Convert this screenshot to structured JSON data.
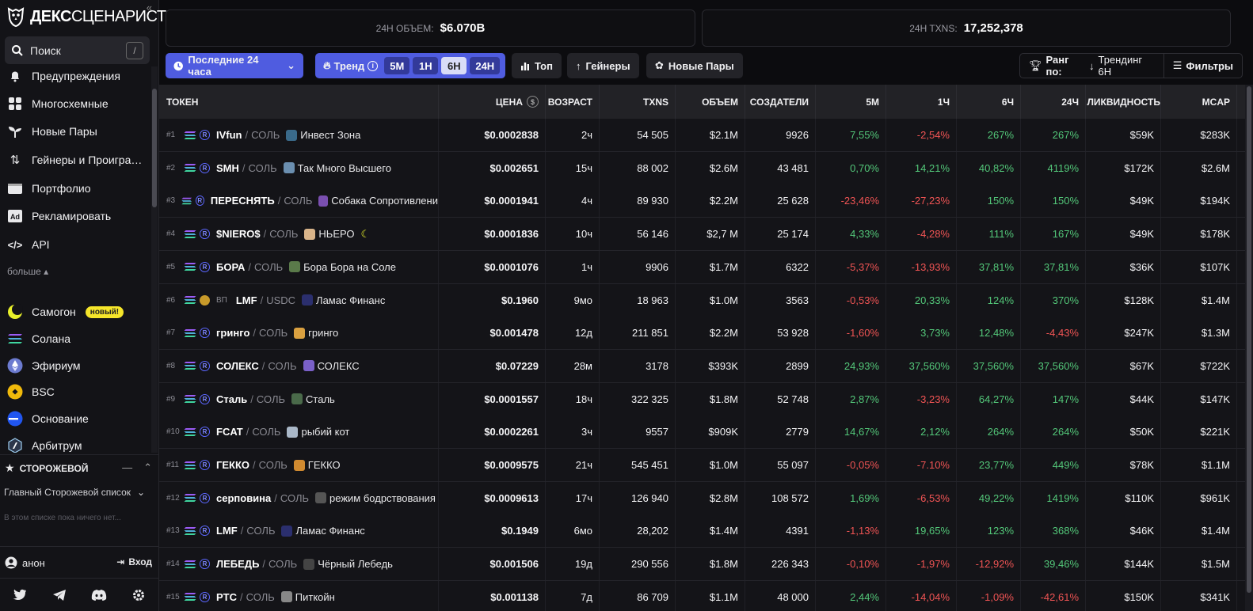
{
  "brand": {
    "bold": "ДЕКС",
    "thin": "СЦЕНАРИСТ"
  },
  "search": {
    "label": "Поиск",
    "shortcut": "/"
  },
  "nav": [
    {
      "label": "Предупреждения",
      "icon": "bell-icon"
    },
    {
      "label": "Многосхемные",
      "icon": "grid-icon"
    },
    {
      "label": "Новые Пары",
      "icon": "sprout-icon"
    },
    {
      "label": "Гейнеры и Проигра…",
      "icon": "arrows-updown-icon"
    },
    {
      "label": "Портфолио",
      "icon": "wallet-icon"
    },
    {
      "label": "Рекламировать",
      "icon": "ad-icon"
    },
    {
      "label": "API",
      "icon": "code-icon"
    }
  ],
  "more_label": "больше",
  "chains": [
    {
      "label": "Самогон",
      "icon": "moonshot-icon",
      "badge": "новый!"
    },
    {
      "label": "Солана",
      "icon": "solana-icon"
    },
    {
      "label": "Эфириум",
      "icon": "ethereum-icon"
    },
    {
      "label": "BSC",
      "icon": "bsc-icon"
    },
    {
      "label": "Основание",
      "icon": "base-icon"
    },
    {
      "label": "Арбитрум",
      "icon": "arbitrum-icon"
    }
  ],
  "watchlist": {
    "title": "СТОРОЖЕВОЙ",
    "selected": "Главный Сторожевой список",
    "empty": "В этом списке пока ничего нет..."
  },
  "user": {
    "name": "анон",
    "login": "Вход"
  },
  "stats": {
    "volume_label": "24H ОБЪЕМ:",
    "volume_value": "$6.070B",
    "txns_label": "24H TXNS:",
    "txns_value": "17,252,378"
  },
  "toolbar": {
    "range": "Последние 24 часа",
    "trend": "Тренд",
    "periods": [
      "5M",
      "1H",
      "6H",
      "24H"
    ],
    "active_period": "6H",
    "top": "Топ",
    "gainers": "Гейнеры",
    "new_pairs": "Новые Пары",
    "rank_by": "Ранг по:",
    "rank_value": "Трендинг 6H",
    "filters": "Фильтры"
  },
  "colors": {
    "accent": "#4f5ce0",
    "positive": "#53c779",
    "negative": "#f05454"
  },
  "table": {
    "headers": [
      "ТОКЕН",
      "ЦЕНА",
      "ВОЗРАСТ",
      "TXNS",
      "ОБЪЕМ",
      "СОЗДАТЕЛИ",
      "5М",
      "1Ч",
      "6Ч",
      "24Ч",
      "ЛИКВИДНОСТЬ",
      "MCAP"
    ],
    "rows": [
      {
        "rank": "#1",
        "sym": "IVfun",
        "quote": "СОЛЬ",
        "name": "Инвест Зона",
        "price": "$0.0002838",
        "age": "2ч",
        "txns": "54 505",
        "vol": "$2.1M",
        "makers": "9926",
        "m5": "7,55%",
        "h1": "-2,54%",
        "h6": "267%",
        "h24": "267%",
        "liq": "$59K",
        "mcap": "$283K"
      },
      {
        "rank": "#2",
        "sym": "SMH",
        "quote": "СОЛЬ",
        "name": "Так Много Высшего",
        "price": "$0.002651",
        "age": "15ч",
        "txns": "88 002",
        "vol": "$2.6M",
        "makers": "43 481",
        "m5": "0,70%",
        "h1": "14,21%",
        "h6": "40,82%",
        "h24": "4119%",
        "liq": "$172K",
        "mcap": "$2.6M"
      },
      {
        "rank": "#3",
        "sym": "ПЕРЕСНЯТЬ",
        "quote": "СОЛЬ",
        "name": "Собака Сопротивлени",
        "price": "$0.0001941",
        "age": "4ч",
        "txns": "89 930",
        "vol": "$2.2M",
        "makers": "25 628",
        "m5": "-23,46%",
        "h1": "-27,23%",
        "h6": "150%",
        "h24": "150%",
        "liq": "$49K",
        "mcap": "$194K"
      },
      {
        "rank": "#4",
        "sym": "$NIERO$",
        "quote": "СОЛЬ",
        "name": "НЬЕРО",
        "price": "$0.0001836",
        "age": "10ч",
        "txns": "56 146",
        "vol": "$2,7 M",
        "makers": "25 174",
        "m5": "4,33%",
        "h1": "-4,28%",
        "h6": "111%",
        "h24": "167%",
        "liq": "$49K",
        "mcap": "$178K"
      },
      {
        "rank": "#5",
        "sym": "БОРА",
        "quote": "СОЛЬ",
        "name": "Бора Бора на Соле",
        "price": "$0.0001076",
        "age": "1ч",
        "txns": "9906",
        "vol": "$1.7M",
        "makers": "6322",
        "m5": "-5,37%",
        "h1": "-13,93%",
        "h6": "37,81%",
        "h24": "37,81%",
        "liq": "$36K",
        "mcap": "$107K"
      },
      {
        "rank": "#6",
        "prefix": "ВП",
        "sym": "LMF",
        "quote": "USDC",
        "name": "Ламас Финанс",
        "price": "$0.1960",
        "age": "9мо",
        "txns": "18 963",
        "vol": "$1.0M",
        "makers": "3563",
        "m5": "-0,53%",
        "h1": "20,33%",
        "h6": "124%",
        "h24": "370%",
        "liq": "$128K",
        "mcap": "$1.4M"
      },
      {
        "rank": "#7",
        "sym": "гринго",
        "quote": "СОЛЬ",
        "name": "гринго",
        "price": "$0.001478",
        "age": "12д",
        "txns": "211 851",
        "vol": "$2.2M",
        "makers": "53 928",
        "m5": "-1,60%",
        "h1": "3,73%",
        "h6": "12,48%",
        "h24": "-4,43%",
        "liq": "$247K",
        "mcap": "$1.3M"
      },
      {
        "rank": "#8",
        "sym": "СОЛЕКС",
        "quote": "СОЛЬ",
        "name": "СОЛЕКС",
        "price": "$0.07229",
        "age": "28м",
        "txns": "3178",
        "vol": "$393K",
        "makers": "2899",
        "m5": "24,93%",
        "h1": "37,560%",
        "h6": "37,560%",
        "h24": "37,560%",
        "liq": "$67K",
        "mcap": "$722K"
      },
      {
        "rank": "#9",
        "sym": "Сталь",
        "quote": "СОЛЬ",
        "name": "Сталь",
        "price": "$0.0001557",
        "age": "18ч",
        "txns": "322 325",
        "vol": "$1.8M",
        "makers": "52 748",
        "m5": "2,87%",
        "h1": "-3,23%",
        "h6": "64,27%",
        "h24": "147%",
        "liq": "$44K",
        "mcap": "$147K"
      },
      {
        "rank": "#10",
        "sym": "FCAT",
        "quote": "СОЛЬ",
        "name": "рыбий кот",
        "price": "$0.0002261",
        "age": "3ч",
        "txns": "9557",
        "vol": "$909K",
        "makers": "2779",
        "m5": "14,67%",
        "h1": "2,12%",
        "h6": "264%",
        "h24": "264%",
        "liq": "$50K",
        "mcap": "$221K"
      },
      {
        "rank": "#11",
        "sym": "ГЕККО",
        "quote": "СОЛЬ",
        "name": "ГЕККО",
        "price": "$0.0009575",
        "age": "21ч",
        "txns": "545 451",
        "vol": "$1.0M",
        "makers": "55 097",
        "m5": "-0,05%",
        "h1": "-7.10%",
        "h6": "23,77%",
        "h24": "449%",
        "liq": "$78K",
        "mcap": "$1.1M"
      },
      {
        "rank": "#12",
        "sym": "серповина",
        "quote": "СОЛЬ",
        "name": "режим бодрствования",
        "price": "$0.0009613",
        "age": "17ч",
        "txns": "126 940",
        "vol": "$2.8M",
        "makers": "108 572",
        "m5": "1,69%",
        "h1": "-6,53%",
        "h6": "49,22%",
        "h24": "1419%",
        "liq": "$110K",
        "mcap": "$961K"
      },
      {
        "rank": "#13",
        "sym": "LMF",
        "quote": "СОЛЬ",
        "name": "Ламас Финанс",
        "price": "$0.1949",
        "age": "6мо",
        "txns": "28,202",
        "vol": "$1.4M",
        "makers": "4391",
        "m5": "-1,13%",
        "h1": "19,65%",
        "h6": "123%",
        "h24": "368%",
        "liq": "$46K",
        "mcap": "$1.4M"
      },
      {
        "rank": "#14",
        "sym": "ЛЕБЕДЬ",
        "quote": "СОЛЬ",
        "name": "Чёрный Лебедь",
        "price": "$0.001506",
        "age": "19д",
        "txns": "290 556",
        "vol": "$1.8M",
        "makers": "226 343",
        "m5": "-0,10%",
        "h1": "-1,97%",
        "h6": "-12,92%",
        "h24": "39,46%",
        "liq": "$144K",
        "mcap": "$1.5M"
      },
      {
        "rank": "#15",
        "sym": "PTC",
        "quote": "СОЛЬ",
        "name": "Питкойн",
        "price": "$0.001138",
        "age": "7д",
        "txns": "86 709",
        "vol": "$1.1M",
        "makers": "48 000",
        "m5": "2,44%",
        "h1": "-14,04%",
        "h6": "-1,09%",
        "h24": "-42,61%",
        "liq": "$150K",
        "mcap": "$341K"
      }
    ]
  }
}
